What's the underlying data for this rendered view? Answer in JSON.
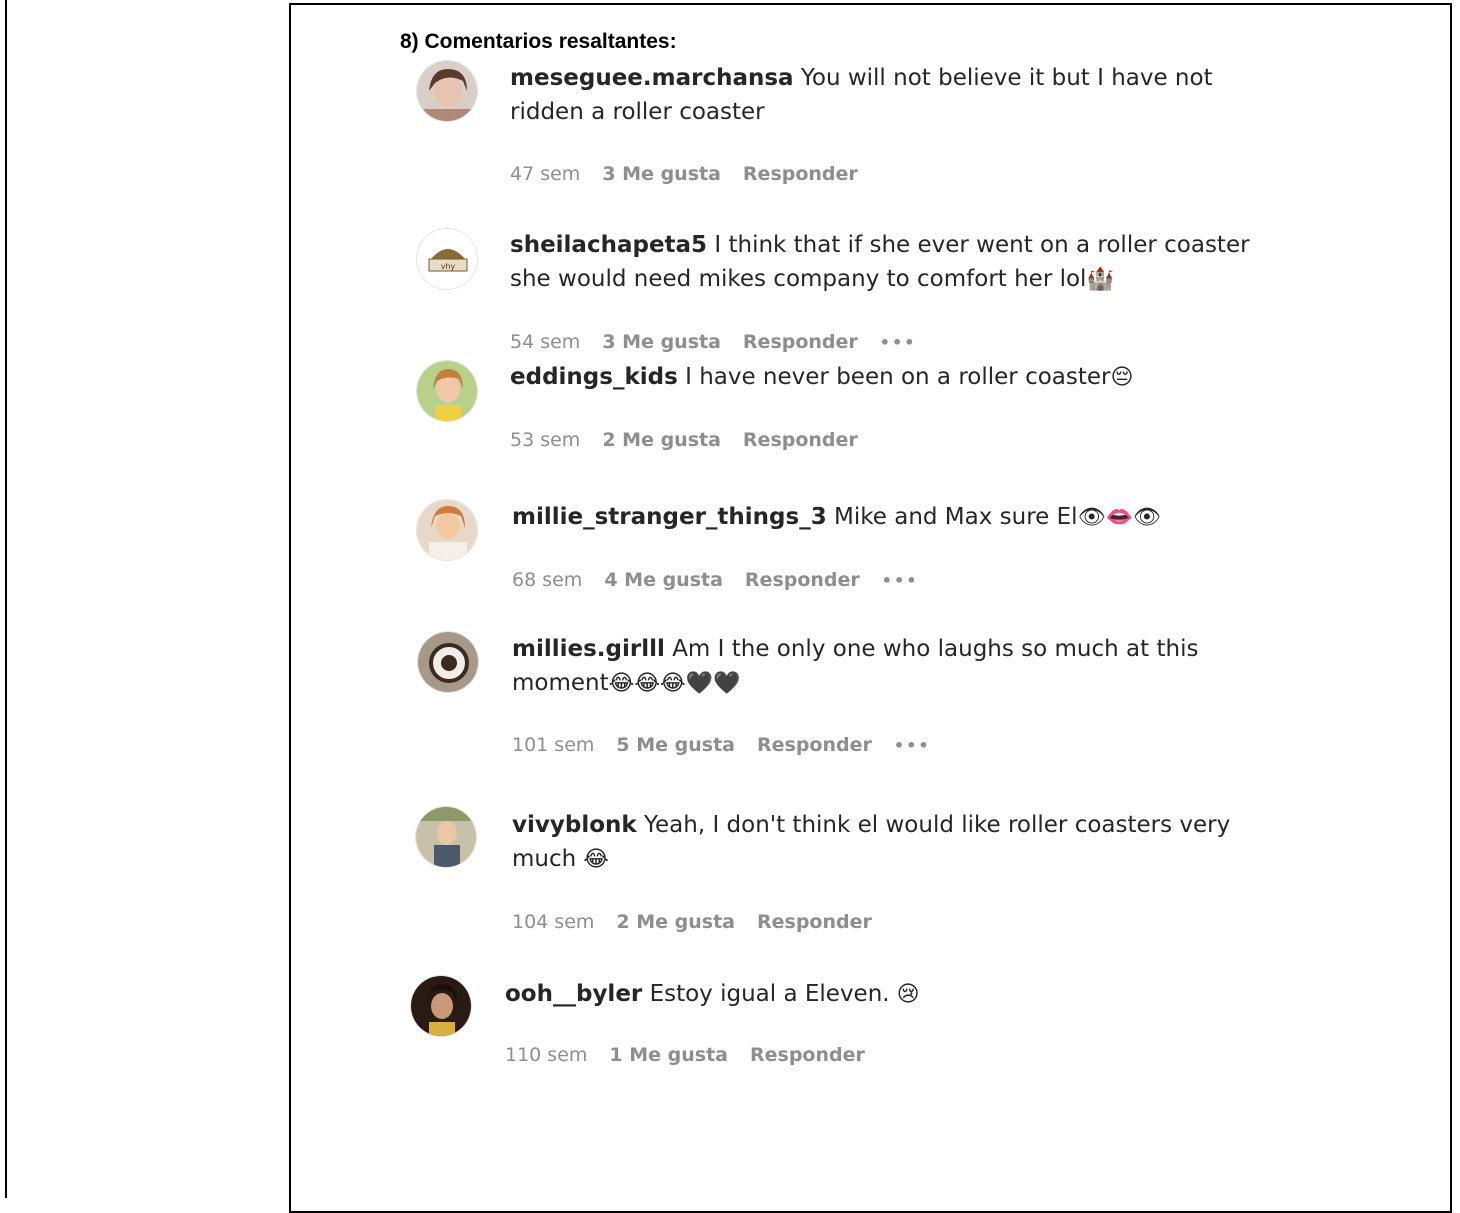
{
  "heading": "8) Comentarios resaltantes:",
  "reply_label": "Responder",
  "comments": [
    {
      "user": "meseguee.marchansa",
      "text": "You will not believe it but I have not ridden a roller coaster",
      "time": "47 sem",
      "likes": "3 Me gusta",
      "more": ""
    },
    {
      "user": "sheilachapeta5",
      "text": "I think that if she ever went on a roller coaster she would need mikes company to comfort her lol",
      "emoji": "🏰",
      "time": "54 sem",
      "likes": "3 Me gusta",
      "more": "•••"
    },
    {
      "user": "eddings_kids",
      "text": "I have never been on a roller coaster",
      "emoji": "😔",
      "time": "53 sem",
      "likes": "2 Me gusta",
      "more": ""
    },
    {
      "user": "millie_stranger_things_3",
      "text": "Mike and Max sure El",
      "emoji": "👁👄👁",
      "time": "68 sem",
      "likes": "4 Me gusta",
      "more": "•••"
    },
    {
      "user": "millies.girlll",
      "text": "Am I the only one who laughs so much at this moment",
      "emoji": "😂😂😂🖤🖤",
      "time": "101 sem",
      "likes": "5 Me gusta",
      "more": "•••"
    },
    {
      "user": "vivyblonk",
      "text": "Yeah, I don't think el would like roller coasters very much",
      "emoji": " 😂",
      "time": "104 sem",
      "likes": "2 Me gusta",
      "more": ""
    },
    {
      "user": "ooh__byler",
      "text": "Estoy igual a Eleven.",
      "emoji": " 😢",
      "time": "110 sem",
      "likes": "1 Me gusta",
      "more": ""
    }
  ],
  "colors": {
    "text": "#262626",
    "meta": "#8e8e8e",
    "border": "#000000"
  }
}
